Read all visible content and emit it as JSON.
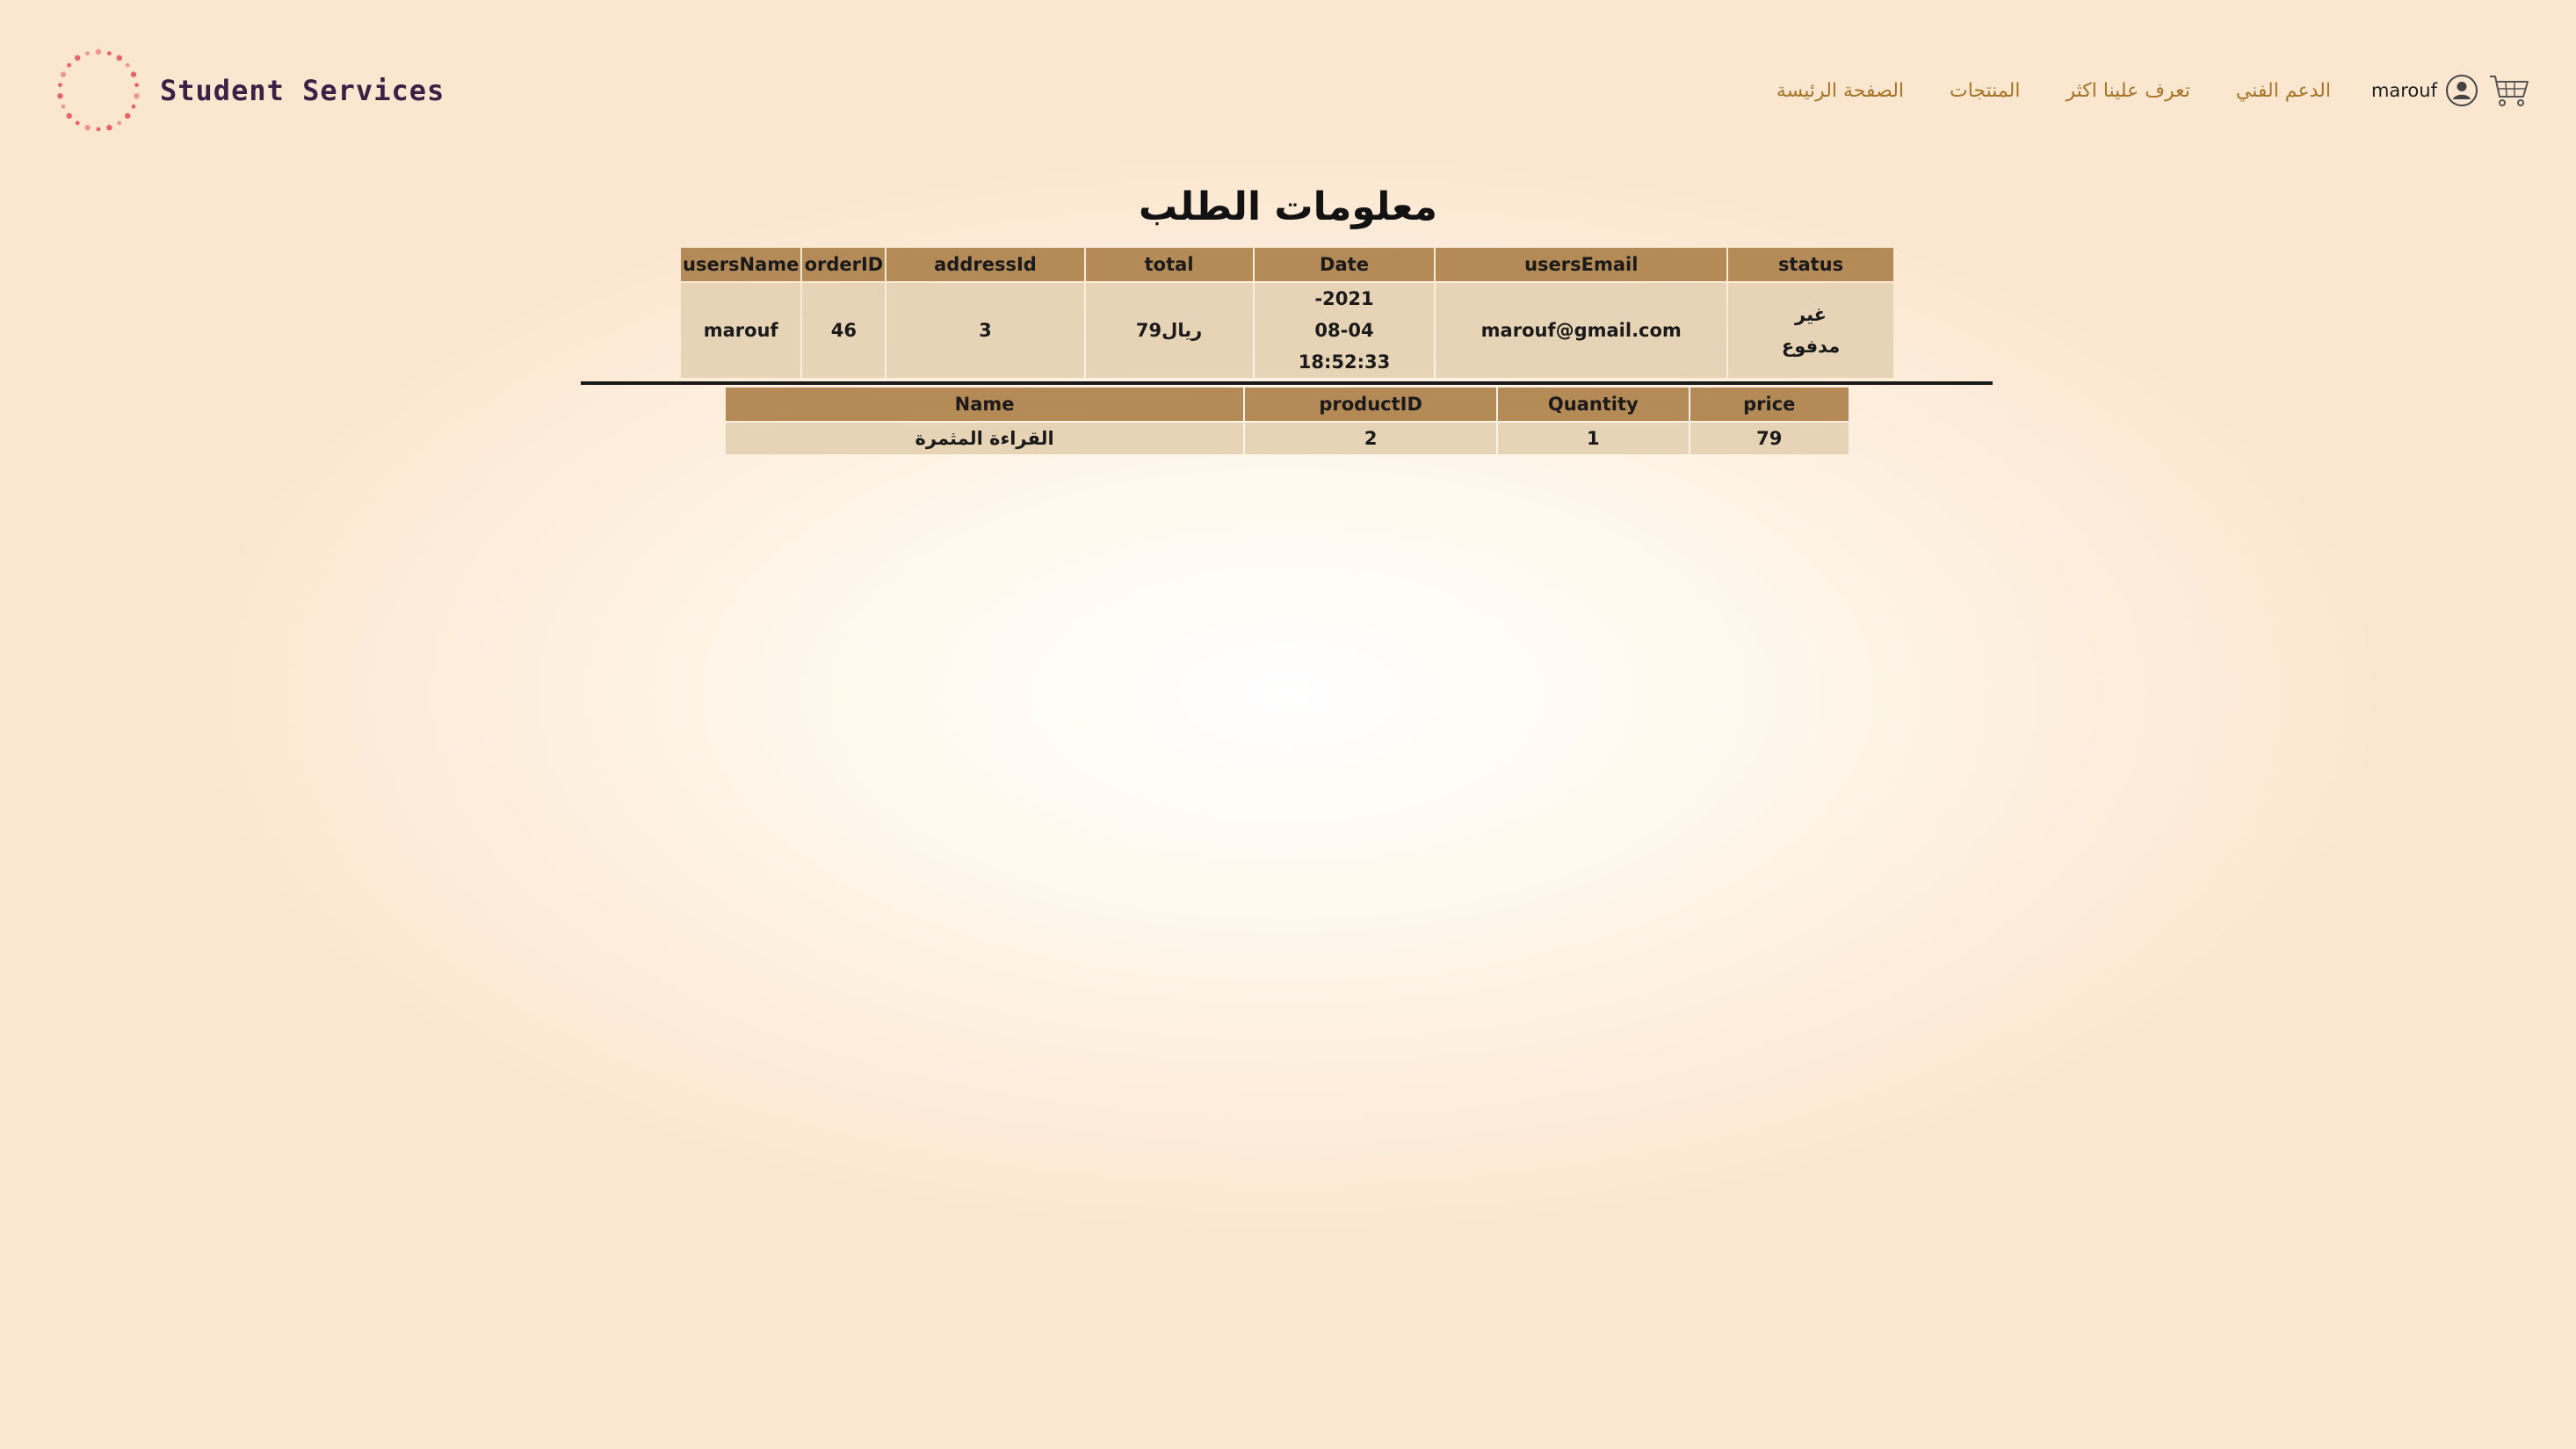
{
  "brand": {
    "name": "Student Services"
  },
  "nav": {
    "links": [
      "الصفحة الرئيسة",
      "المنتجات",
      "تعرف علينا اكثر",
      "الدعم الفني"
    ],
    "user_name": "marouf"
  },
  "icons": {
    "logo": "dotted-circle-logo",
    "user": "user-circle-icon",
    "cart": "shopping-cart-icon"
  },
  "colors": {
    "header_cell": "#b48a57",
    "body_cell": "#e7d3b6",
    "nav_link": "#a87428",
    "brand_text": "#3c2046",
    "logo_dots": "#e8545a"
  },
  "page": {
    "title": "معلومات الطلب"
  },
  "order_table": {
    "headers": [
      "usersName",
      "orderID",
      "addressId",
      "total",
      "Date",
      "usersEmail",
      "status"
    ],
    "row": {
      "usersName": "marouf",
      "orderID": "46",
      "addressId": "3",
      "total": "ريال79",
      "date_line1": "-2021",
      "date_line2": "08-04",
      "date_line3": "18:52:33",
      "usersEmail": "marouf@gmail.com",
      "status_line1": "غير",
      "status_line2": "مدفوع"
    }
  },
  "items_table": {
    "headers": [
      "Name",
      "productID",
      "Quantity",
      "price"
    ],
    "rows": [
      {
        "name": "القراءة المثمرة",
        "productID": "2",
        "quantity": "1",
        "price": "79"
      }
    ]
  }
}
